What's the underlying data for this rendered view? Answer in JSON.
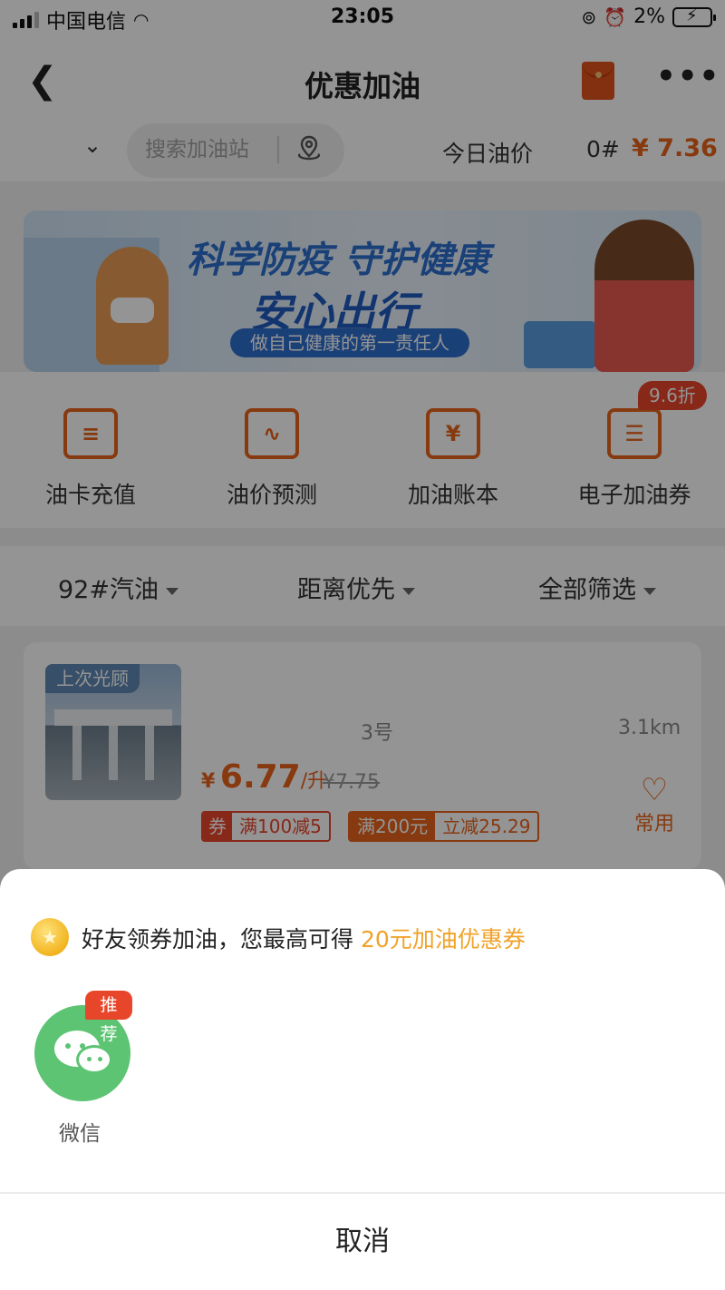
{
  "status_bar": {
    "carrier": "中国电信",
    "time": "23:05",
    "battery": "2%"
  },
  "nav": {
    "title": "优惠加油"
  },
  "search": {
    "placeholder": "搜索加油站",
    "today_price_label": "今日油价",
    "fuel_grade": "0#",
    "price": "¥ 7.36"
  },
  "banner": {
    "line1": "科学防疫 守护健康",
    "line2": "安心出行",
    "line3": "做自己健康的第一责任人"
  },
  "entries": [
    {
      "label": "油卡充值",
      "icon": "fuel-card-icon"
    },
    {
      "label": "油价预测",
      "icon": "price-forecast-icon"
    },
    {
      "label": "加油账本",
      "icon": "ledger-icon"
    },
    {
      "label": "电子加油券",
      "icon": "e-coupon-icon"
    }
  ],
  "discount_badge": "9.6折",
  "filters": {
    "fuel": "92#汽油",
    "sort": "距离优先",
    "all": "全部筛选"
  },
  "station": {
    "tag": "上次光顾",
    "name": "3号",
    "distance": "3.1km",
    "currency": "¥",
    "price": "6.77",
    "unit": "/升",
    "original_price": "¥7.75",
    "coupon_key": "券",
    "coupon_value": "满100减5",
    "deal_a": "满200元",
    "deal_b": "立减25.29",
    "favorite_label": "常用"
  },
  "share_sheet": {
    "promo_prefix": "好友领券加油，您最高可得 ",
    "promo_highlight": "20元加油优惠券",
    "wechat_label": "微信",
    "recommend_badge": "推荐",
    "cancel": "取消"
  },
  "colors": {
    "accent": "#e8641b",
    "badge_red": "#e8462b",
    "wechat_green": "#5dc473",
    "promo_orange": "#f0a22a"
  }
}
